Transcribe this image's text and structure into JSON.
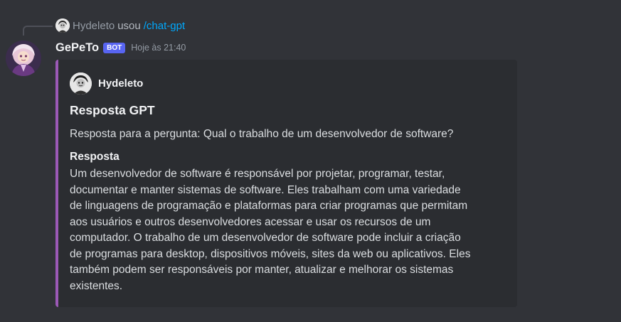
{
  "reply": {
    "user": "Hydeleto",
    "verb": "usou",
    "command": "/chat-gpt"
  },
  "message": {
    "author": "GePeTo",
    "tag": "BOT",
    "timestamp": "Hoje às 21:40"
  },
  "embed": {
    "accent_color": "#9b59b6",
    "author": "Hydeleto",
    "title": "Resposta GPT",
    "description": "Resposta para a pergunta: Qual o trabalho de um desenvolvedor de software?",
    "field_name": "Resposta",
    "field_value": "Um desenvolvedor de software é responsável por projetar, programar, testar,\ndocumentar e manter sistemas de software. Eles trabalham com uma variedade\nde linguagens de programação e plataformas para criar programas que permitam\naos usuários e outros desenvolvedores acessar e usar os recursos de um\ncomputador. O trabalho de um desenvolvedor de software pode incluir a criação\nde programas para desktop, dispositivos móveis, sites da web ou aplicativos. Eles\ntambém podem ser responsáveis por manter, atualizar e melhorar os sistemas\nexistentes."
  },
  "colors": {
    "background": "#313338",
    "embed_background": "#2b2d31",
    "command_link": "#00a8fc",
    "bot_tag": "#5865f2"
  }
}
